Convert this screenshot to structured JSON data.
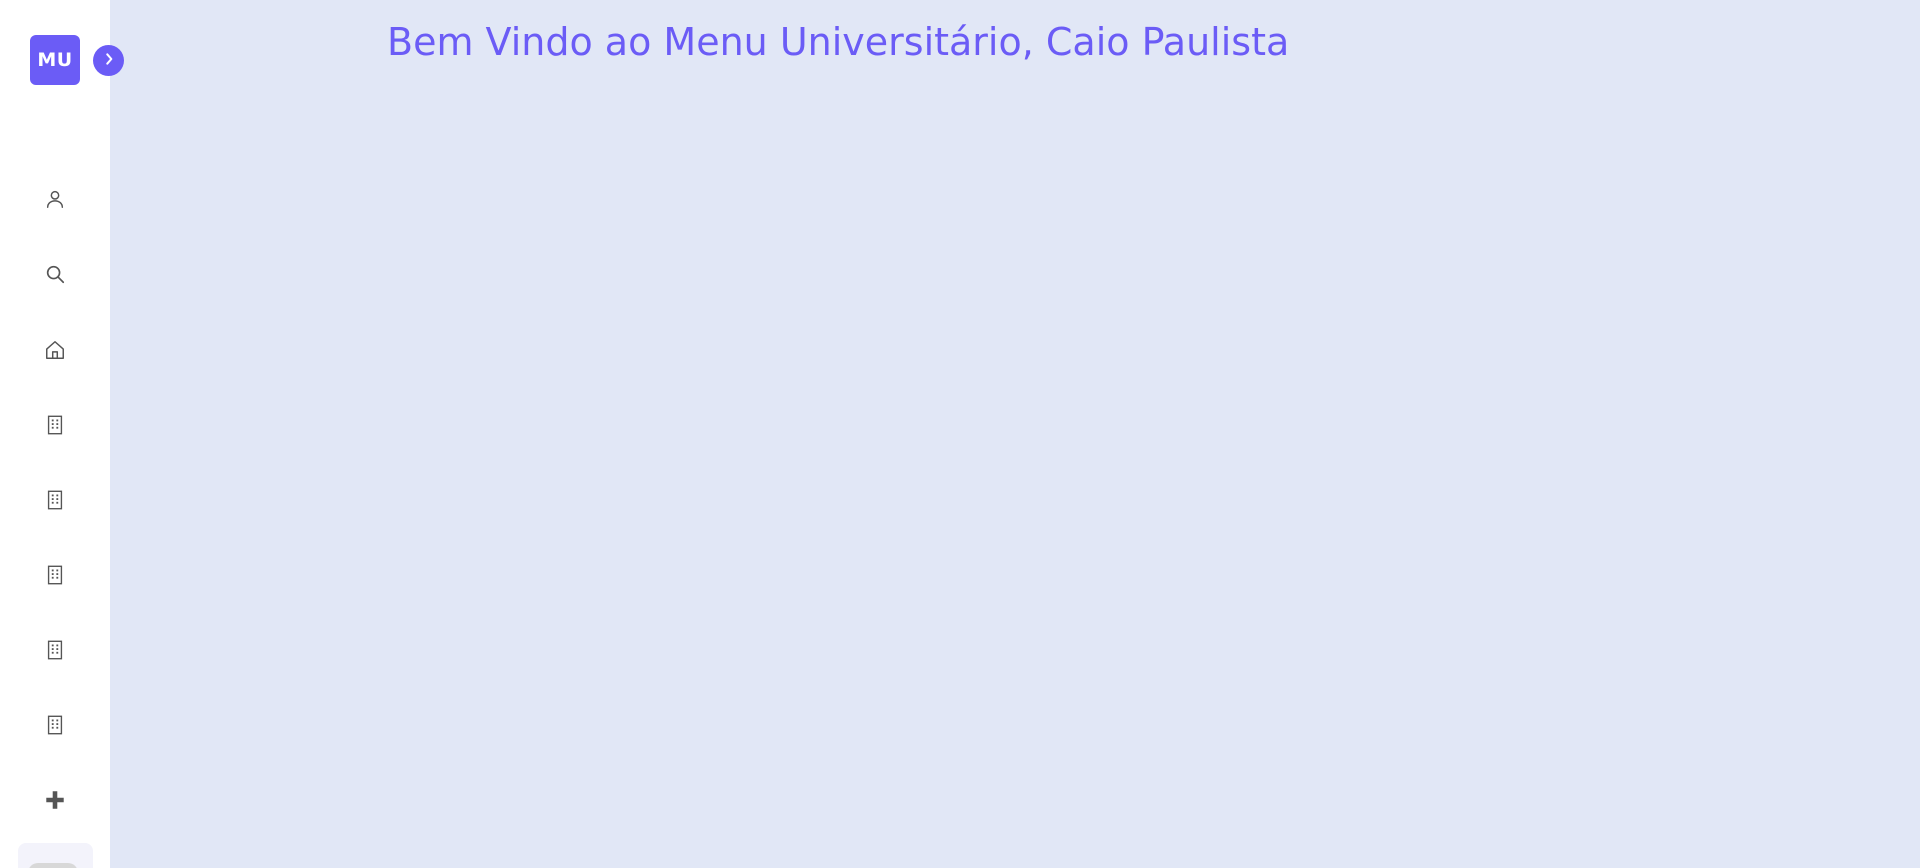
{
  "app": {
    "logo_text": "MU",
    "accent_color": "#6b5cf6",
    "background_color": "#e1e7f6",
    "sidebar_background": "#ffffff"
  },
  "sidebar": {
    "toggle_icon": "chevron-right-icon",
    "items": [
      {
        "icon": "user-icon"
      },
      {
        "icon": "search-icon"
      },
      {
        "icon": "home-icon"
      },
      {
        "icon": "building-icon"
      },
      {
        "icon": "building-icon"
      },
      {
        "icon": "building-icon"
      },
      {
        "icon": "building-icon"
      },
      {
        "icon": "building-icon"
      },
      {
        "icon": "plus-icon"
      }
    ],
    "theme_toggle_icon": "theme-toggle-switch"
  },
  "main": {
    "welcome_text": "Bem Vindo ao Menu Universitário, Caio Paulista"
  }
}
